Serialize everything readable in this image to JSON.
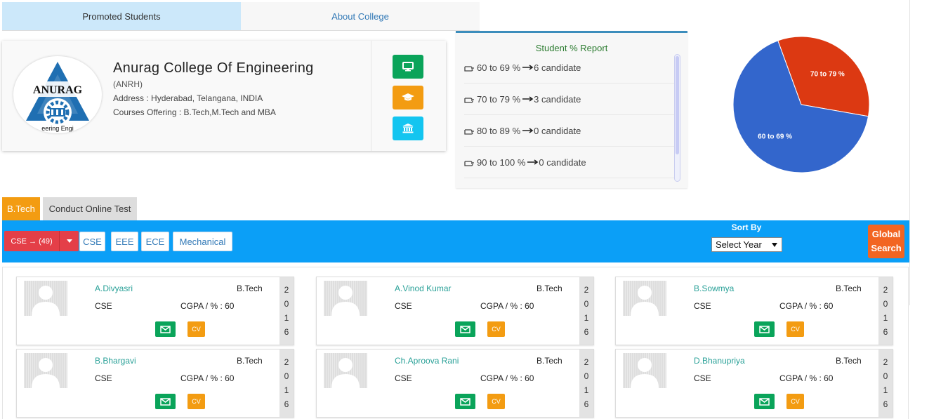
{
  "top_tabs": {
    "promoted": "Promoted Students",
    "about": "About College"
  },
  "college": {
    "logo_text": "ANURAG",
    "logo_subtext": "eering Engi",
    "name": "Anurag College Of Engineering",
    "code": "(ANRH)",
    "address": "Address : Hyderabad, Telangana, INDIA",
    "courses": "Courses Offering : B.Tech,M.Tech and MBA",
    "icons": [
      "desktop-icon",
      "graduation-cap-icon",
      "institution-icon"
    ]
  },
  "report": {
    "title": "Student % Report",
    "rows": [
      {
        "range": "60 to 69 %",
        "count": "6 candidate"
      },
      {
        "range": "70 to 79 %",
        "count": "3 candidate"
      },
      {
        "range": "80 to 89 %",
        "count": "0 candidate"
      },
      {
        "range": "90 to 100 %",
        "count": "0 candidate"
      }
    ]
  },
  "chart_data": {
    "type": "pie",
    "labels": [
      "60 to 69 %",
      "70 to 79 %"
    ],
    "values": [
      6,
      3
    ],
    "colors": [
      "#3366cc",
      "#dc3912"
    ]
  },
  "course_tabs": {
    "btech": "B.Tech",
    "online": "Conduct Online Test"
  },
  "toolbar": {
    "dept_selected": "CSE → (49)",
    "dept_buttons": [
      "CSE",
      "EEE",
      "ECE",
      "Mechanical"
    ],
    "sort_label": "Sort By",
    "year_select": "Select Year",
    "global_line1": "Global",
    "global_line2": "Search"
  },
  "colors": {
    "bar": "#0b9ff7",
    "green": "#0aa45a",
    "orange": "#f39c12",
    "cyan": "#13c5f0",
    "red": "#e43f48"
  },
  "students": [
    {
      "name": "A.Divyasri",
      "course": "B.Tech",
      "branch": "CSE",
      "cgpa": "CGPA / % : 60",
      "year": [
        "2",
        "0",
        "1",
        "6"
      ],
      "cv": "CV"
    },
    {
      "name": "A.Vinod Kumar",
      "course": "B.Tech",
      "branch": "CSE",
      "cgpa": "CGPA / % : 60",
      "year": [
        "2",
        "0",
        "1",
        "6"
      ],
      "cv": "CV"
    },
    {
      "name": "B.Sowmya",
      "course": "B.Tech",
      "branch": "CSE",
      "cgpa": "CGPA / % : 60",
      "year": [
        "2",
        "0",
        "1",
        "6"
      ],
      "cv": "CV"
    },
    {
      "name": "B.Bhargavi",
      "course": "B.Tech",
      "branch": "CSE",
      "cgpa": "CGPA / % : 60",
      "year": [
        "2",
        "0",
        "1",
        "6"
      ],
      "cv": "CV"
    },
    {
      "name": "Ch.Aproova Rani",
      "course": "B.Tech",
      "branch": "CSE",
      "cgpa": "CGPA / % : 60",
      "year": [
        "2",
        "0",
        "1",
        "6"
      ],
      "cv": "CV"
    },
    {
      "name": "D.Bhanupriya",
      "course": "B.Tech",
      "branch": "CSE",
      "cgpa": "CGPA / % : 60",
      "year": [
        "2",
        "0",
        "1",
        "6"
      ],
      "cv": "CV"
    }
  ]
}
